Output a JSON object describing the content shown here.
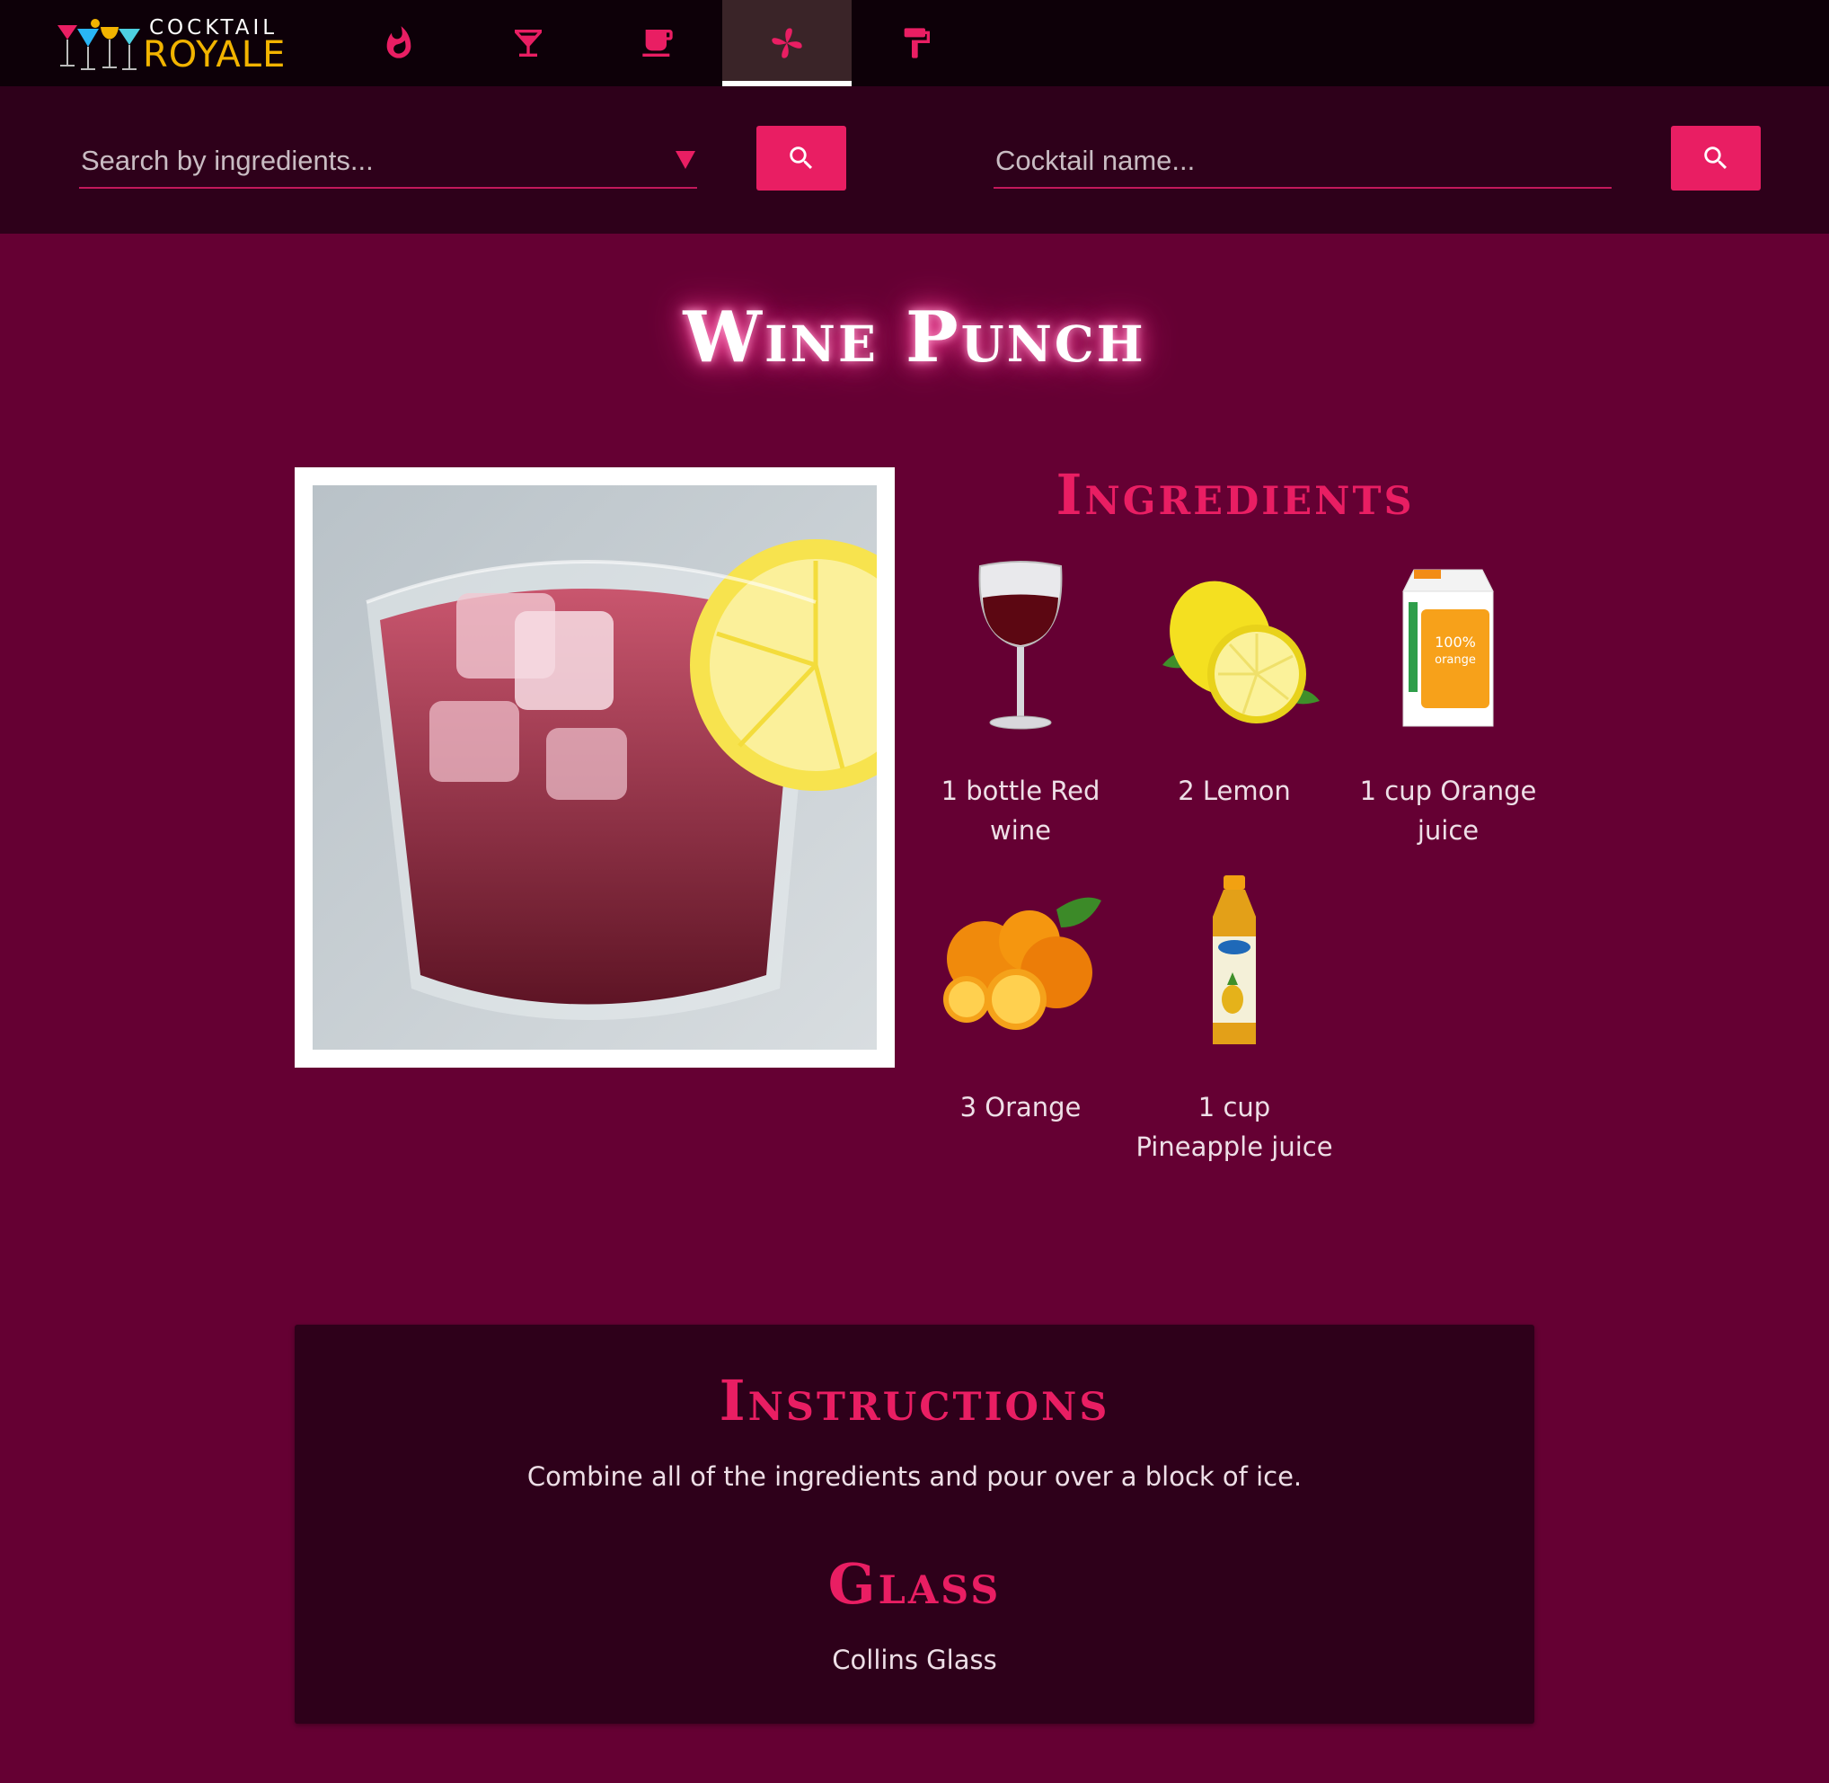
{
  "brand": {
    "name_top": "COCKTAIL",
    "name_bottom": "ROYALE"
  },
  "nav": {
    "tabs": [
      {
        "icon": "flame-icon",
        "active": false
      },
      {
        "icon": "martini-glass-icon",
        "active": false
      },
      {
        "icon": "coffee-cup-icon",
        "active": false
      },
      {
        "icon": "pinwheel-icon",
        "active": true
      },
      {
        "icon": "paint-roller-icon",
        "active": false
      }
    ]
  },
  "search": {
    "ingredients_placeholder": "Search by ingredients...",
    "name_placeholder": "Cocktail name..."
  },
  "cocktail": {
    "title": "Wine Punch",
    "ingredients_heading": "Ingredients",
    "ingredients": [
      {
        "label": "1 bottle Red wine",
        "image": "red-wine-glass"
      },
      {
        "label": "2 Lemon",
        "image": "lemon"
      },
      {
        "label": "1 cup Orange juice",
        "image": "orange-juice-carton"
      },
      {
        "label": "3 Orange",
        "image": "oranges"
      },
      {
        "label": "1 cup Pineapple juice",
        "image": "pineapple-juice-bottle"
      }
    ],
    "instructions_heading": "Instructions",
    "instructions": "Combine all of the ingredients and pour over a block of ice.",
    "glass_heading": "Glass",
    "glass": "Collins Glass"
  },
  "colors": {
    "page_bg": "#650033",
    "nav_bg": "#0d0008",
    "search_bg": "#2e001a",
    "accent": "#e91e63",
    "panel_bg": "#2e001a"
  }
}
